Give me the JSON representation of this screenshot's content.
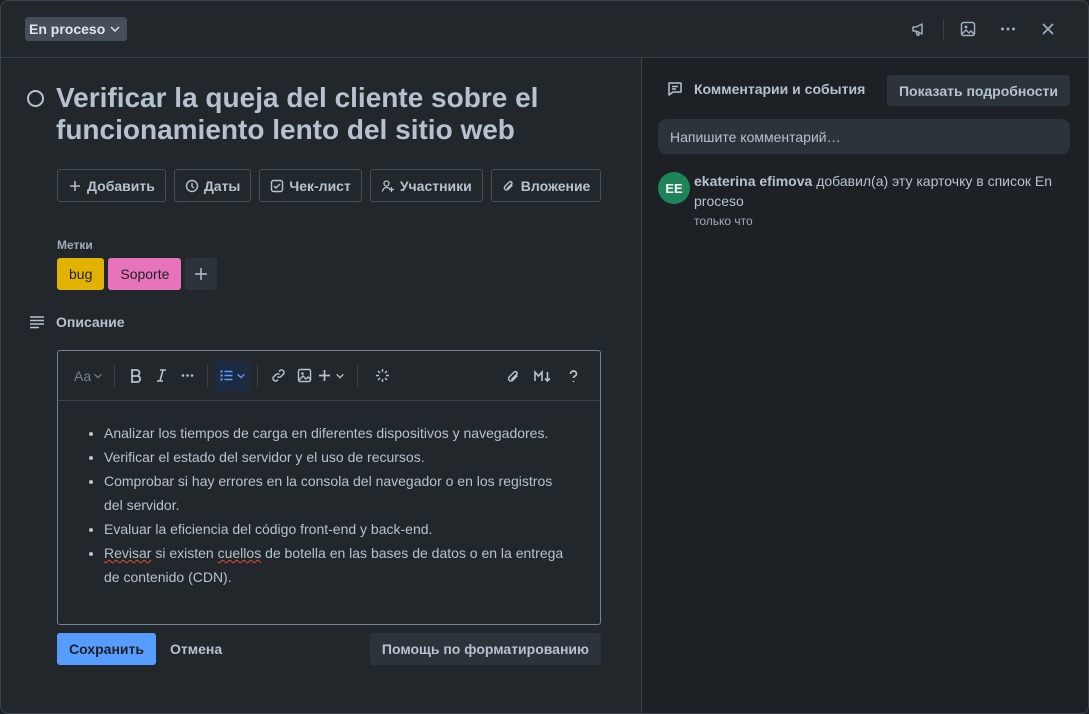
{
  "header": {
    "status_label": "En proceso",
    "icons": [
      "megaphone-icon",
      "image-icon",
      "more-icon",
      "close-icon"
    ]
  },
  "card": {
    "title": "Verificar la queja del cliente sobre el funcionamiento lento del sitio web",
    "actions": [
      {
        "label": "Добавить",
        "icon": "plus-icon"
      },
      {
        "label": "Даты",
        "icon": "clock-icon"
      },
      {
        "label": "Чек-лист",
        "icon": "checklist-icon"
      },
      {
        "label": "Участники",
        "icon": "members-icon"
      },
      {
        "label": "Вложение",
        "icon": "paperclip-icon"
      }
    ],
    "labels_title": "Метки",
    "labels": [
      {
        "text": "bug",
        "color": "#e2b203"
      },
      {
        "text": "Soporte",
        "color": "#e774bb"
      }
    ],
    "description_title": "Описание",
    "editor": {
      "font_button": "Aa",
      "items": [
        "Analizar los tiempos de carga en diferentes dispositivos y navegadores.",
        "Verificar el estado del servidor y el uso de recursos.",
        "Comprobar si hay errores en la consola del navegador o en los registros del servidor.",
        "Evaluar la eficiencia del código front-end y back-end.",
        "Revisar si existen cuellos de botella en las bases de datos o en la entrega de contenido (CDN)."
      ]
    },
    "save_label": "Сохранить",
    "cancel_label": "Отмена",
    "help_label": "Помощь по форматированию"
  },
  "activity": {
    "title": "Комментарии и события",
    "details_label": "Показать подробности",
    "comment_placeholder": "Напишите комментарий…",
    "events": [
      {
        "initials": "EE",
        "user": "ekaterina efimova",
        "text": "добавил(а) эту карточку в список En proceso",
        "time": "только что"
      }
    ]
  },
  "colors": {
    "accent": "#579dff",
    "avatar": "#1f845a"
  }
}
